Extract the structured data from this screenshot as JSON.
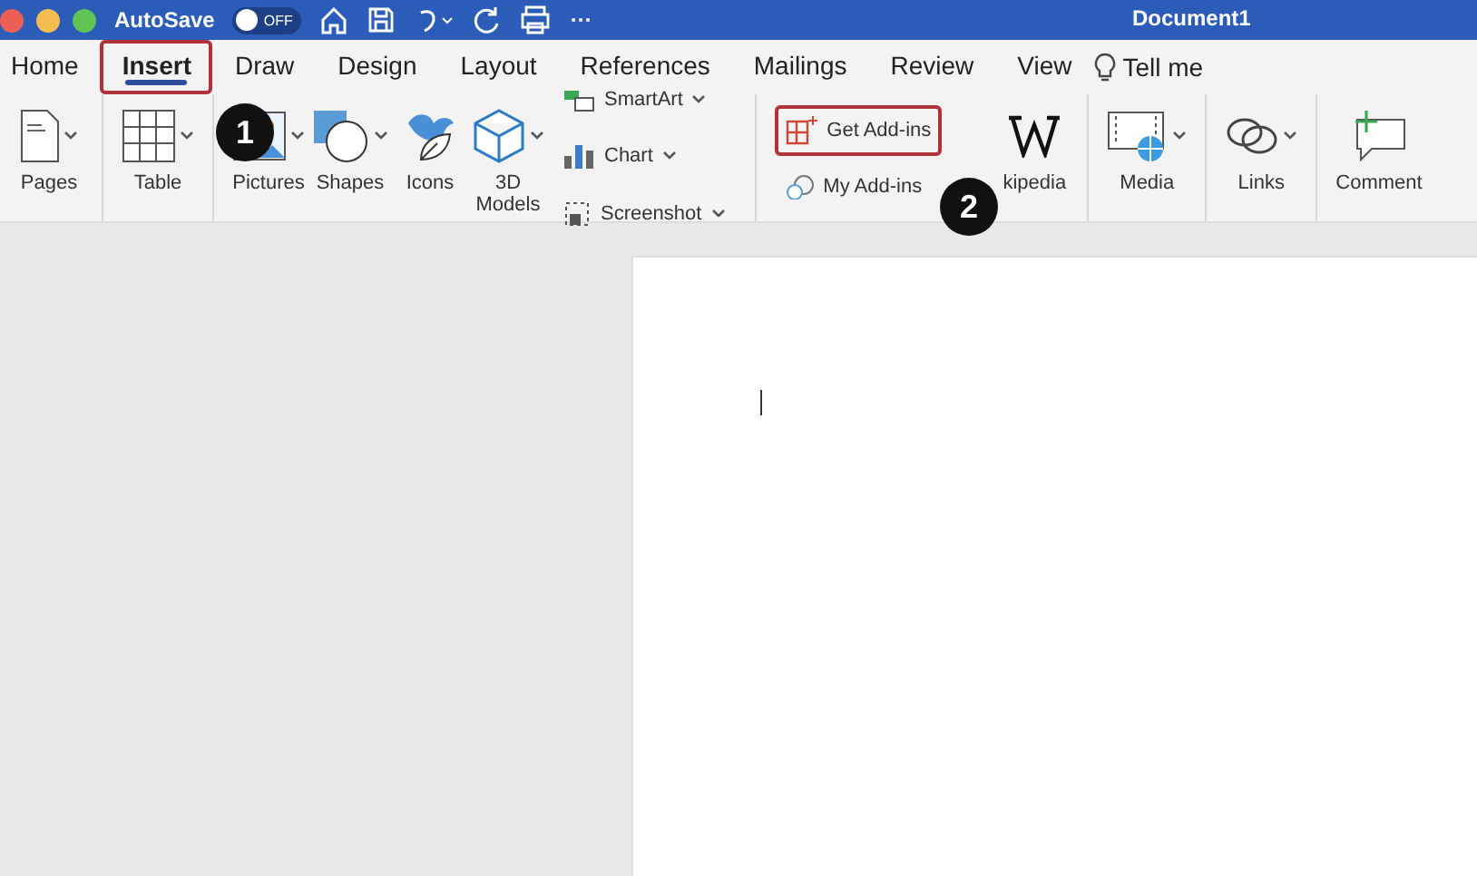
{
  "window": {
    "title": "Document1",
    "autosave_label": "AutoSave",
    "autosave_on": false,
    "autosave_state": "OFF",
    "more": "···"
  },
  "tabs": [
    {
      "label": "Home",
      "selected": false,
      "highlighted": false
    },
    {
      "label": "Insert",
      "selected": true,
      "highlighted": true
    },
    {
      "label": "Draw",
      "selected": false,
      "highlighted": false
    },
    {
      "label": "Design",
      "selected": false,
      "highlighted": false
    },
    {
      "label": "Layout",
      "selected": false,
      "highlighted": false
    },
    {
      "label": "References",
      "selected": false,
      "highlighted": false
    },
    {
      "label": "Mailings",
      "selected": false,
      "highlighted": false
    },
    {
      "label": "Review",
      "selected": false,
      "highlighted": false
    },
    {
      "label": "View",
      "selected": false,
      "highlighted": false
    }
  ],
  "tell_me": "Tell me",
  "ribbon": {
    "groups": [
      {
        "items": [
          {
            "kind": "large",
            "label": "Pages",
            "dropdown": true
          }
        ]
      },
      {
        "items": [
          {
            "kind": "large",
            "label": "Table",
            "dropdown": true
          }
        ]
      },
      {
        "items": [
          {
            "kind": "large",
            "label": "Pictures",
            "dropdown": true
          },
          {
            "kind": "large",
            "label": "Shapes",
            "dropdown": true
          },
          {
            "kind": "large",
            "label": "Icons",
            "dropdown": false
          },
          {
            "kind": "large",
            "label": "3D Models",
            "dropdown": true
          },
          {
            "kind": "stack",
            "entries": [
              {
                "label": "SmartArt",
                "dropdown": true,
                "highlighted": false
              },
              {
                "label": "Chart",
                "dropdown": true,
                "highlighted": false
              },
              {
                "label": "Screenshot",
                "dropdown": true,
                "highlighted": false
              }
            ]
          }
        ]
      },
      {
        "items": [
          {
            "kind": "stack",
            "entries": [
              {
                "label": "Get Add-ins",
                "dropdown": false,
                "highlighted": true
              },
              {
                "label": "My Add-ins",
                "dropdown": false,
                "highlighted": false
              }
            ]
          },
          {
            "kind": "large",
            "label": "kipedia",
            "dropdown": false
          }
        ]
      },
      {
        "items": [
          {
            "kind": "large",
            "label": "Media",
            "dropdown": true
          }
        ]
      },
      {
        "items": [
          {
            "kind": "large",
            "label": "Links",
            "dropdown": true
          }
        ]
      },
      {
        "items": [
          {
            "kind": "large",
            "label": "Comment",
            "dropdown": false
          }
        ]
      }
    ]
  },
  "callouts": [
    {
      "label": "1"
    },
    {
      "label": "2"
    }
  ]
}
